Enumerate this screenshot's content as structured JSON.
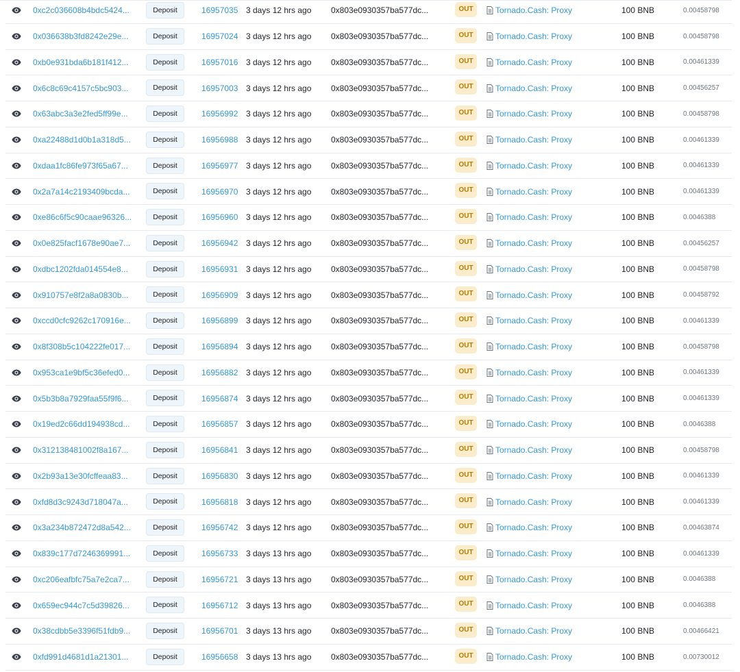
{
  "colors": {
    "link": "#3498db",
    "out_bg": "#fbeccb",
    "out_text": "#b47d00",
    "method_bg": "#eef5fb"
  },
  "icons": {
    "view": "eye-icon",
    "contract": "document-icon"
  },
  "rows": [
    {
      "hash": "0xc2c036608b4bdc5424...",
      "method": "Deposit",
      "block": "16957035",
      "age": "3 days 12 hrs ago",
      "from": "0x803e0930357ba577dc...",
      "direction": "OUT",
      "to": "Tornado.Cash: Proxy",
      "value": "100 BNB",
      "fee": "0.00458798"
    },
    {
      "hash": "0x036638b3fd8242e29e...",
      "method": "Deposit",
      "block": "16957024",
      "age": "3 days 12 hrs ago",
      "from": "0x803e0930357ba577dc...",
      "direction": "OUT",
      "to": "Tornado.Cash: Proxy",
      "value": "100 BNB",
      "fee": "0.00458798"
    },
    {
      "hash": "0xb0e931bda6b181f412...",
      "method": "Deposit",
      "block": "16957016",
      "age": "3 days 12 hrs ago",
      "from": "0x803e0930357ba577dc...",
      "direction": "OUT",
      "to": "Tornado.Cash: Proxy",
      "value": "100 BNB",
      "fee": "0.00461339"
    },
    {
      "hash": "0x6c8c69c4157c5bc903...",
      "method": "Deposit",
      "block": "16957003",
      "age": "3 days 12 hrs ago",
      "from": "0x803e0930357ba577dc...",
      "direction": "OUT",
      "to": "Tornado.Cash: Proxy",
      "value": "100 BNB",
      "fee": "0.00456257"
    },
    {
      "hash": "0x63abc3a3e2fed5ff99e...",
      "method": "Deposit",
      "block": "16956992",
      "age": "3 days 12 hrs ago",
      "from": "0x803e0930357ba577dc...",
      "direction": "OUT",
      "to": "Tornado.Cash: Proxy",
      "value": "100 BNB",
      "fee": "0.00458798"
    },
    {
      "hash": "0xa22488d1d0b1a318d5...",
      "method": "Deposit",
      "block": "16956988",
      "age": "3 days 12 hrs ago",
      "from": "0x803e0930357ba577dc...",
      "direction": "OUT",
      "to": "Tornado.Cash: Proxy",
      "value": "100 BNB",
      "fee": "0.00461339"
    },
    {
      "hash": "0xdaa1fc86fe973f65a67...",
      "method": "Deposit",
      "block": "16956977",
      "age": "3 days 12 hrs ago",
      "from": "0x803e0930357ba577dc...",
      "direction": "OUT",
      "to": "Tornado.Cash: Proxy",
      "value": "100 BNB",
      "fee": "0.00461339"
    },
    {
      "hash": "0x2a7a14c2193409bcda...",
      "method": "Deposit",
      "block": "16956970",
      "age": "3 days 12 hrs ago",
      "from": "0x803e0930357ba577dc...",
      "direction": "OUT",
      "to": "Tornado.Cash: Proxy",
      "value": "100 BNB",
      "fee": "0.00461339"
    },
    {
      "hash": "0xe86c6f5c90caae96326...",
      "method": "Deposit",
      "block": "16956960",
      "age": "3 days 12 hrs ago",
      "from": "0x803e0930357ba577dc...",
      "direction": "OUT",
      "to": "Tornado.Cash: Proxy",
      "value": "100 BNB",
      "fee": "0.0046388"
    },
    {
      "hash": "0x0e825facf1678e90ae7...",
      "method": "Deposit",
      "block": "16956942",
      "age": "3 days 12 hrs ago",
      "from": "0x803e0930357ba577dc...",
      "direction": "OUT",
      "to": "Tornado.Cash: Proxy",
      "value": "100 BNB",
      "fee": "0.00456257"
    },
    {
      "hash": "0xdbc1202fda014554e8...",
      "method": "Deposit",
      "block": "16956931",
      "age": "3 days 12 hrs ago",
      "from": "0x803e0930357ba577dc...",
      "direction": "OUT",
      "to": "Tornado.Cash: Proxy",
      "value": "100 BNB",
      "fee": "0.00458798"
    },
    {
      "hash": "0x910757e8f2a8a0830b...",
      "method": "Deposit",
      "block": "16956909",
      "age": "3 days 12 hrs ago",
      "from": "0x803e0930357ba577dc...",
      "direction": "OUT",
      "to": "Tornado.Cash: Proxy",
      "value": "100 BNB",
      "fee": "0.00458792"
    },
    {
      "hash": "0xccd0cfc9262c170916e...",
      "method": "Deposit",
      "block": "16956899",
      "age": "3 days 12 hrs ago",
      "from": "0x803e0930357ba577dc...",
      "direction": "OUT",
      "to": "Tornado.Cash: Proxy",
      "value": "100 BNB",
      "fee": "0.00461339"
    },
    {
      "hash": "0x8f308b5c104222fe017...",
      "method": "Deposit",
      "block": "16956894",
      "age": "3 days 12 hrs ago",
      "from": "0x803e0930357ba577dc...",
      "direction": "OUT",
      "to": "Tornado.Cash: Proxy",
      "value": "100 BNB",
      "fee": "0.00458798"
    },
    {
      "hash": "0x953ca1e9bf5c36efed0...",
      "method": "Deposit",
      "block": "16956882",
      "age": "3 days 12 hrs ago",
      "from": "0x803e0930357ba577dc...",
      "direction": "OUT",
      "to": "Tornado.Cash: Proxy",
      "value": "100 BNB",
      "fee": "0.00461339"
    },
    {
      "hash": "0x5b3b8a7929faa55f9f6...",
      "method": "Deposit",
      "block": "16956874",
      "age": "3 days 12 hrs ago",
      "from": "0x803e0930357ba577dc...",
      "direction": "OUT",
      "to": "Tornado.Cash: Proxy",
      "value": "100 BNB",
      "fee": "0.00461339"
    },
    {
      "hash": "0x19ed2c66dd194938cd...",
      "method": "Deposit",
      "block": "16956857",
      "age": "3 days 12 hrs ago",
      "from": "0x803e0930357ba577dc...",
      "direction": "OUT",
      "to": "Tornado.Cash: Proxy",
      "value": "100 BNB",
      "fee": "0.0046388"
    },
    {
      "hash": "0x312138481002f8a167...",
      "method": "Deposit",
      "block": "16956841",
      "age": "3 days 12 hrs ago",
      "from": "0x803e0930357ba577dc...",
      "direction": "OUT",
      "to": "Tornado.Cash: Proxy",
      "value": "100 BNB",
      "fee": "0.00458798"
    },
    {
      "hash": "0x2b93a13e30fcffeaa83...",
      "method": "Deposit",
      "block": "16956830",
      "age": "3 days 12 hrs ago",
      "from": "0x803e0930357ba577dc...",
      "direction": "OUT",
      "to": "Tornado.Cash: Proxy",
      "value": "100 BNB",
      "fee": "0.00461339"
    },
    {
      "hash": "0xfd8d3c9243d718047a...",
      "method": "Deposit",
      "block": "16956818",
      "age": "3 days 12 hrs ago",
      "from": "0x803e0930357ba577dc...",
      "direction": "OUT",
      "to": "Tornado.Cash: Proxy",
      "value": "100 BNB",
      "fee": "0.00461339"
    },
    {
      "hash": "0x3a234b872472d8a542...",
      "method": "Deposit",
      "block": "16956742",
      "age": "3 days 12 hrs ago",
      "from": "0x803e0930357ba577dc...",
      "direction": "OUT",
      "to": "Tornado.Cash: Proxy",
      "value": "100 BNB",
      "fee": "0.00463874"
    },
    {
      "hash": "0x839c177d7246369991...",
      "method": "Deposit",
      "block": "16956733",
      "age": "3 days 13 hrs ago",
      "from": "0x803e0930357ba577dc...",
      "direction": "OUT",
      "to": "Tornado.Cash: Proxy",
      "value": "100 BNB",
      "fee": "0.00461339"
    },
    {
      "hash": "0xc206eafbfc75a7e2ca7...",
      "method": "Deposit",
      "block": "16956721",
      "age": "3 days 13 hrs ago",
      "from": "0x803e0930357ba577dc...",
      "direction": "OUT",
      "to": "Tornado.Cash: Proxy",
      "value": "100 BNB",
      "fee": "0.0046388"
    },
    {
      "hash": "0x659ec944c7c5d39826...",
      "method": "Deposit",
      "block": "16956712",
      "age": "3 days 13 hrs ago",
      "from": "0x803e0930357ba577dc...",
      "direction": "OUT",
      "to": "Tornado.Cash: Proxy",
      "value": "100 BNB",
      "fee": "0.0046388"
    },
    {
      "hash": "0x38cdbb5e3396f51fdb9...",
      "method": "Deposit",
      "block": "16956701",
      "age": "3 days 13 hrs ago",
      "from": "0x803e0930357ba577dc...",
      "direction": "OUT",
      "to": "Tornado.Cash: Proxy",
      "value": "100 BNB",
      "fee": "0.00466421"
    },
    {
      "hash": "0xfd991d4681d1a21301...",
      "method": "Deposit",
      "block": "16956658",
      "age": "3 days 13 hrs ago",
      "from": "0x803e0930357ba577dc...",
      "direction": "OUT",
      "to": "Tornado.Cash: Proxy",
      "value": "100 BNB",
      "fee": "0.00730012"
    }
  ]
}
